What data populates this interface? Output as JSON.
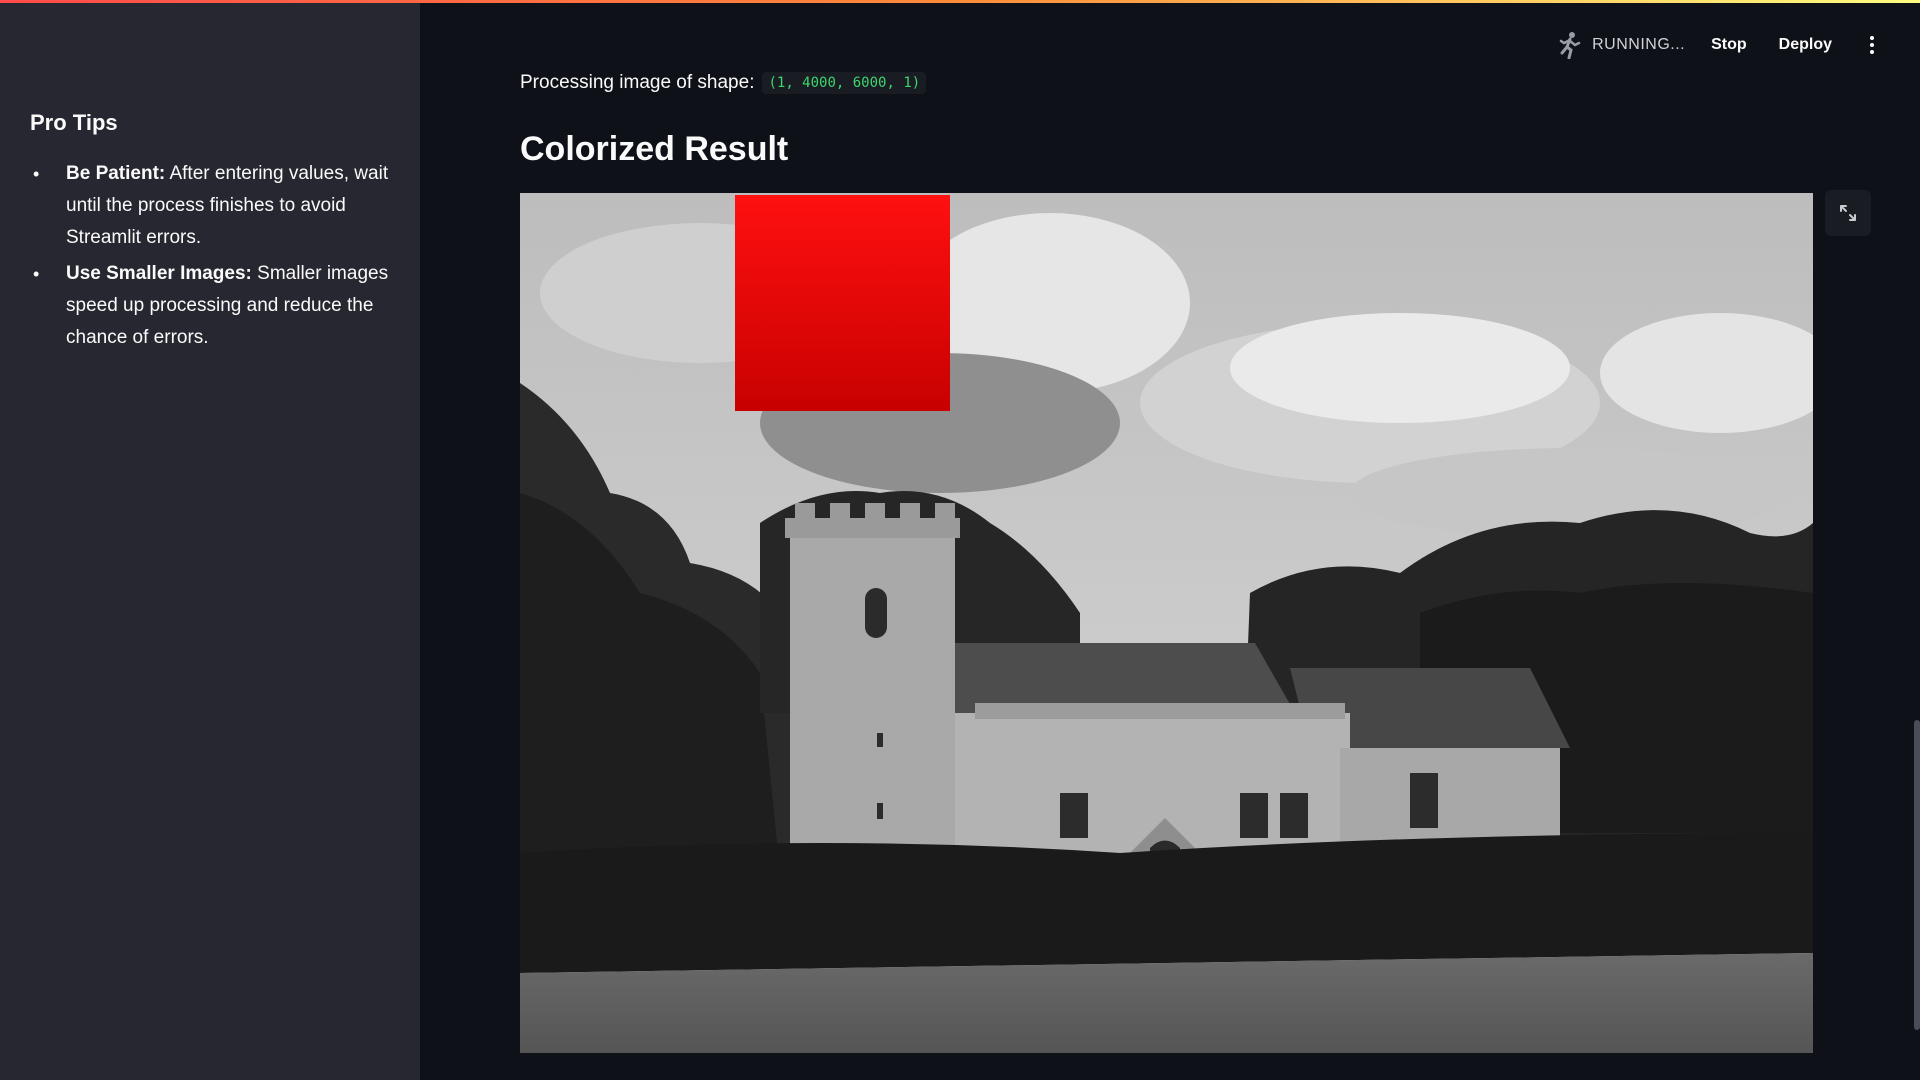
{
  "header": {
    "status_label": "RUNNING...",
    "stop_label": "Stop",
    "deploy_label": "Deploy",
    "running_icon": "running-man-icon",
    "menu_icon": "vertical-dots-icon"
  },
  "sidebar": {
    "title": "Pro Tips",
    "tips": [
      {
        "bold": "Be Patient:",
        "text": " After entering values, wait until the process finishes to avoid Streamlit errors."
      },
      {
        "bold": "Use Smaller Images:",
        "text": " Smaller images speed up processing and reduce the chance of errors."
      }
    ]
  },
  "main": {
    "shape_label": "Processing image of shape:",
    "shape_value": "(1, 4000, 6000, 1)",
    "result_title": "Colorized Result",
    "fullscreen_icon": "fullscreen-expand-icon"
  },
  "colors": {
    "background": "#0e1117",
    "sidebar": "#262730",
    "accent_red": "#ff4b4b",
    "code_green": "#3dd56d",
    "overlay_red": "#ff0000"
  }
}
